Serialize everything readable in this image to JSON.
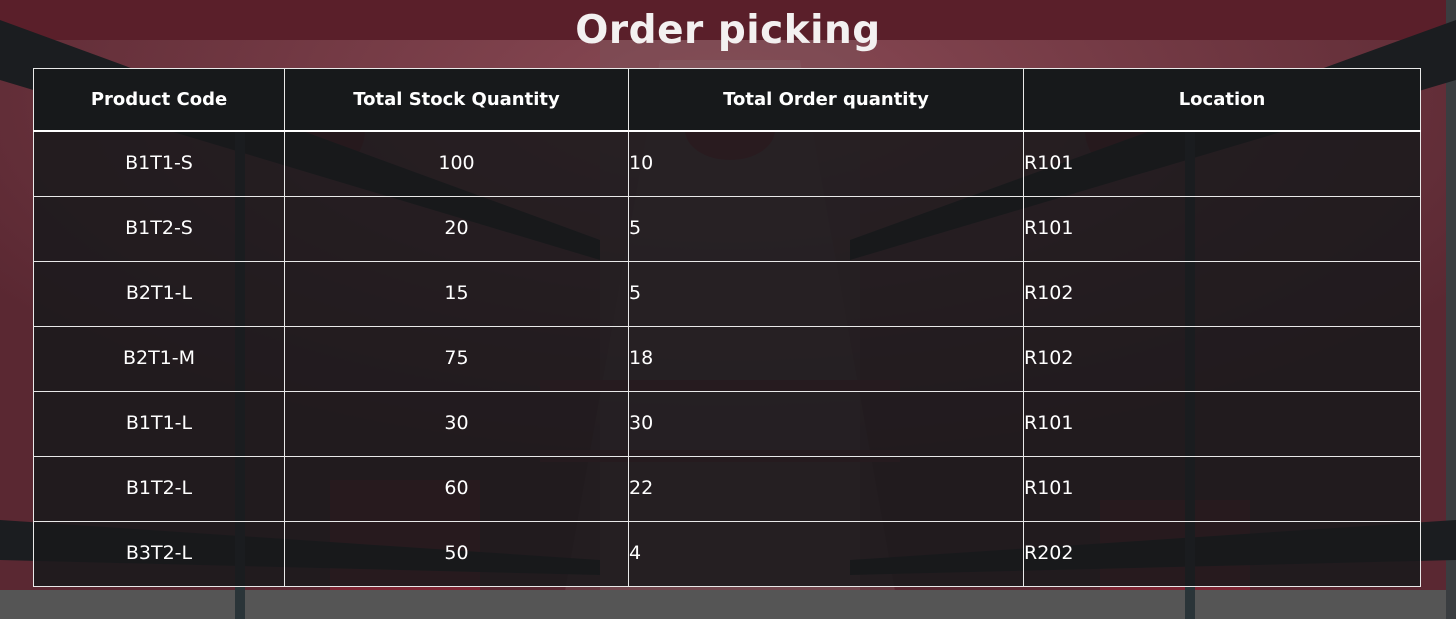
{
  "page": {
    "title": "Order picking"
  },
  "table": {
    "columns": [
      "Product Code",
      "Total Stock Quantity",
      "Total Order quantity",
      "Location"
    ],
    "rows": [
      {
        "code": "B1T1-S",
        "stock": "100",
        "order": "10",
        "location": "R101"
      },
      {
        "code": "B1T2-S",
        "stock": "20",
        "order": "5",
        "location": "R101"
      },
      {
        "code": "B2T1-L",
        "stock": "15",
        "order": "5",
        "location": "R102"
      },
      {
        "code": "B2T1-M",
        "stock": "75",
        "order": "18",
        "location": "R102"
      },
      {
        "code": "B1T1-L",
        "stock": "30",
        "order": "30",
        "location": "R101"
      },
      {
        "code": "B1T2-L",
        "stock": "60",
        "order": "22",
        "location": "R101"
      },
      {
        "code": "B3T2-L",
        "stock": "50",
        "order": "4",
        "location": "R202"
      }
    ]
  },
  "colors": {
    "background": "#6a3440",
    "table_fill": "#17191b",
    "border": "#e9e9e9",
    "text": "#ffffff"
  }
}
